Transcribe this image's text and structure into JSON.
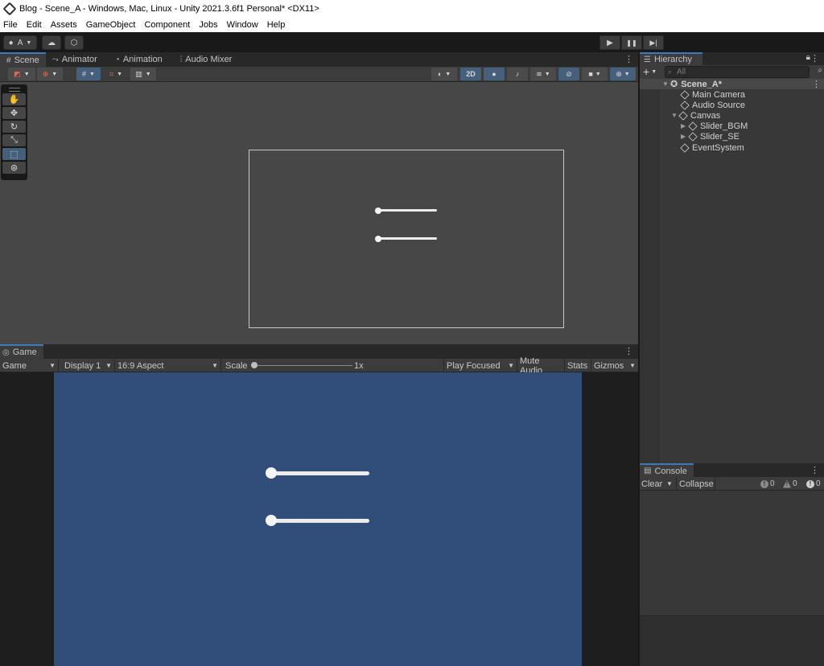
{
  "window": {
    "title": "Blog - Scene_A - Windows, Mac, Linux - Unity 2021.3.6f1 Personal* <DX11>"
  },
  "menu": [
    "File",
    "Edit",
    "Assets",
    "GameObject",
    "Component",
    "Jobs",
    "Window",
    "Help"
  ],
  "toolbar": {
    "account_label": "A",
    "play_icon": "▶",
    "pause_icon": "❚❚",
    "step_icon": "▶|"
  },
  "scene_tabs": [
    {
      "label": "Scene",
      "icon": "#"
    },
    {
      "label": "Animator",
      "icon": "⤳"
    },
    {
      "label": "Animation",
      "icon": "◔"
    },
    {
      "label": "Audio Mixer",
      "icon": "⫶"
    }
  ],
  "scene_toolbar": {
    "mode_2d": "2D"
  },
  "game": {
    "tab_label": "Game",
    "mode": "Game",
    "display": "Display 1",
    "aspect": "16:9 Aspect",
    "scale_label": "Scale",
    "scale_value": "1x",
    "play_mode": "Play Focused",
    "mute_label": "Mute Audio",
    "stats_label": "Stats",
    "gizmos_label": "Gizmos"
  },
  "hierarchy": {
    "tab_label": "Hierarchy",
    "search_placeholder": "All",
    "scene_name": "Scene_A*",
    "items": [
      {
        "name": "Main Camera"
      },
      {
        "name": "Audio Source"
      },
      {
        "name": "Canvas"
      },
      {
        "name": "Slider_BGM"
      },
      {
        "name": "Slider_SE"
      },
      {
        "name": "EventSystem"
      }
    ]
  },
  "console": {
    "tab_label": "Console",
    "clear_label": "Clear",
    "collapse_label": "Collapse",
    "info_count": "0",
    "warning_count": "0",
    "error_count": "0"
  },
  "colors": {
    "game_bg": "#314e7a",
    "accent": "#3a79bb"
  }
}
